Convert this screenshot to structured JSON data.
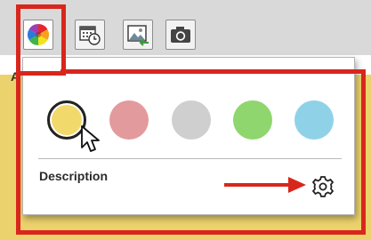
{
  "toolbar": {
    "buttons": [
      {
        "name": "color-picker-button",
        "icon": "color-wheel-icon",
        "active": true
      },
      {
        "name": "calendar-button",
        "icon": "calendar-clock-icon",
        "active": false
      },
      {
        "name": "image-import-button",
        "icon": "image-import-icon",
        "active": false
      },
      {
        "name": "camera-button",
        "icon": "camera-icon",
        "active": false
      }
    ]
  },
  "background": {
    "partial_label": "A"
  },
  "popup": {
    "swatches": [
      {
        "name": "swatch-yellow",
        "color": "#f2d96b",
        "selected": true
      },
      {
        "name": "swatch-red",
        "color": "#e39a9d",
        "selected": false
      },
      {
        "name": "swatch-gray",
        "color": "#cfcfcf",
        "selected": false
      },
      {
        "name": "swatch-green",
        "color": "#8fd66e",
        "selected": false
      },
      {
        "name": "swatch-blue",
        "color": "#8fd2e8",
        "selected": false
      }
    ],
    "description_label": "Description",
    "settings_icon": "gear-icon"
  },
  "annotations": {
    "highlight_color": "#d9261c",
    "background_highlight": "#ecd26c"
  }
}
